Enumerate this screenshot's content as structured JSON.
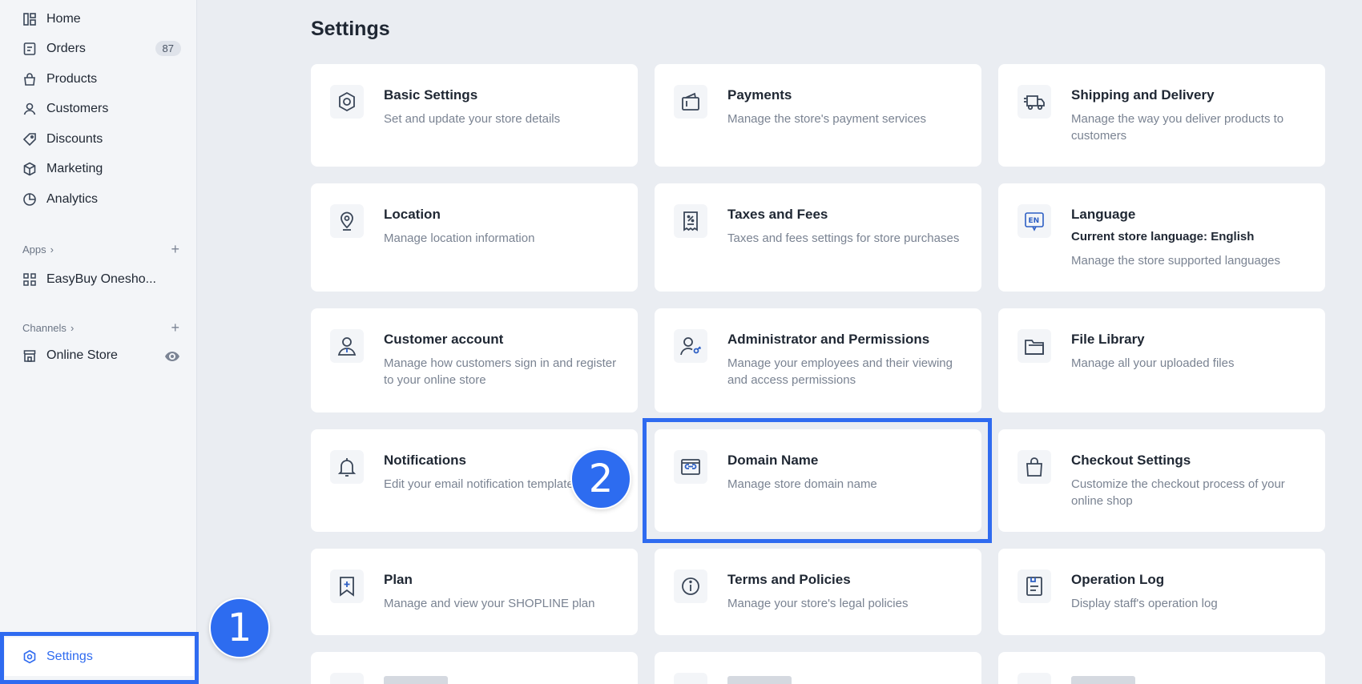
{
  "sidebar": {
    "nav": [
      {
        "label": "Home",
        "icon": "home-icon"
      },
      {
        "label": "Orders",
        "icon": "orders-icon",
        "badge": "87"
      },
      {
        "label": "Products",
        "icon": "bag-icon"
      },
      {
        "label": "Customers",
        "icon": "person-icon"
      },
      {
        "label": "Discounts",
        "icon": "tag-icon"
      },
      {
        "label": "Marketing",
        "icon": "cube-icon"
      },
      {
        "label": "Analytics",
        "icon": "pie-icon"
      }
    ],
    "apps_label": "Apps",
    "app_item": "EasyBuy Onesho...",
    "channels_label": "Channels",
    "channel_item": "Online Store",
    "settings_label": "Settings"
  },
  "page": {
    "title": "Settings",
    "cards": [
      {
        "title": "Basic Settings",
        "desc": "Set and update your store details",
        "icon": "gear-icon"
      },
      {
        "title": "Payments",
        "desc": "Manage the store's payment services",
        "icon": "wallet-icon"
      },
      {
        "title": "Shipping and Delivery",
        "desc": "Manage the way you deliver products to customers",
        "icon": "truck-icon"
      },
      {
        "title": "Location",
        "desc": "Manage location information",
        "icon": "location-icon"
      },
      {
        "title": "Taxes and Fees",
        "desc": "Taxes and fees settings for store purchases",
        "icon": "receipt-icon"
      },
      {
        "title": "Language",
        "sub": "Current store language: English",
        "desc": "Manage the store supported languages",
        "icon": "language-icon"
      },
      {
        "title": "Customer account",
        "desc": "Manage how customers sign in and register to your online store",
        "icon": "account-icon"
      },
      {
        "title": "Administrator and Permissions",
        "desc": "Manage your employees and their viewing and access permissions",
        "icon": "admin-key-icon"
      },
      {
        "title": "File Library",
        "desc": "Manage all your uploaded files",
        "icon": "folder-icon"
      },
      {
        "title": "Notifications",
        "desc": "Edit your email notification templates",
        "icon": "bell-icon"
      },
      {
        "title": "Domain Name",
        "desc": "Manage store domain name",
        "icon": "domain-link-icon"
      },
      {
        "title": "Checkout Settings",
        "desc": "Customize the checkout process of your online shop",
        "icon": "shopping-bag-icon"
      },
      {
        "title": "Plan",
        "desc": "Manage and view your SHOPLINE plan",
        "icon": "bookmark-plus-icon"
      },
      {
        "title": "Terms and Policies",
        "desc": "Manage your store's legal policies",
        "icon": "info-icon"
      },
      {
        "title": "Operation Log",
        "desc": "Display staff's operation log",
        "icon": "log-icon"
      }
    ]
  },
  "annotations": {
    "step1": "1",
    "step2": "2"
  },
  "colors": {
    "accent": "#2f6bf0",
    "background": "#eaedf2",
    "card": "#ffffff",
    "icon": "#3a4658"
  }
}
